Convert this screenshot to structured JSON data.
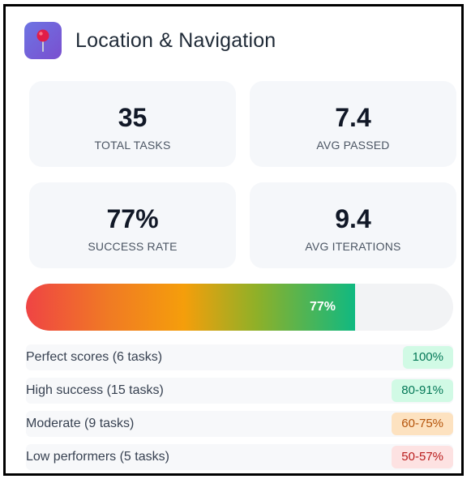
{
  "header": {
    "title": "Location & Navigation",
    "icon": "pushpin-icon",
    "icon_bg": "#6d74e3"
  },
  "stats": [
    {
      "value": "35",
      "label": "TOTAL TASKS"
    },
    {
      "value": "7.4",
      "label": "AVG PASSED"
    },
    {
      "value": "77%",
      "label": "SUCCESS RATE"
    },
    {
      "value": "9.4",
      "label": "AVG ITERATIONS"
    }
  ],
  "progress": {
    "label": "77%",
    "fraction": 0.77
  },
  "breakdown": [
    {
      "label": "Perfect scores (6 tasks)",
      "badge": "100%",
      "badge_bg": "#d1fae5",
      "badge_color": "#047857"
    },
    {
      "label": "High success (15 tasks)",
      "badge": "80-91%",
      "badge_bg": "#d1fae5",
      "badge_color": "#047857"
    },
    {
      "label": "Moderate (9 tasks)",
      "badge": "60-75%",
      "badge_bg": "#fde2c0",
      "badge_color": "#b45309"
    },
    {
      "label": "Low performers (5 tasks)",
      "badge": "50-57%",
      "badge_bg": "#fde2e2",
      "badge_color": "#b91c1c"
    }
  ]
}
